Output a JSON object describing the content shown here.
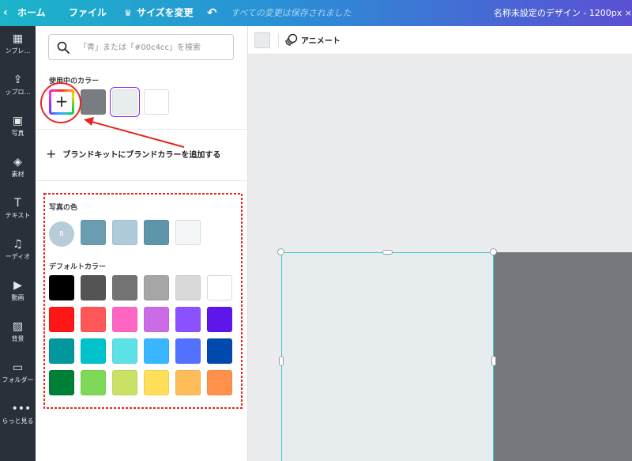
{
  "topbar": {
    "back_icon": "‹",
    "home": "ホーム",
    "file": "ファイル",
    "crown_icon": "♛",
    "resize": "サイズを変更",
    "undo_icon": "↶",
    "saved_status": "すべての変更は保存されました",
    "title": "名称未設定のデザイン - 1200px ×"
  },
  "rail": [
    {
      "icon": "template-icon",
      "glyph": "▦",
      "label": "ンプレ…"
    },
    {
      "icon": "upload-icon",
      "glyph": "⇪",
      "label": "ップロ…"
    },
    {
      "icon": "photo-icon",
      "glyph": "▣",
      "label": "写真"
    },
    {
      "icon": "elements-icon",
      "glyph": "◈",
      "label": "素材"
    },
    {
      "icon": "text-icon",
      "glyph": "T",
      "label": "テキスト"
    },
    {
      "icon": "audio-icon",
      "glyph": "♫",
      "label": "ーディオ"
    },
    {
      "icon": "video-icon",
      "glyph": "▶",
      "label": "動画"
    },
    {
      "icon": "background-icon",
      "glyph": "▨",
      "label": "背景"
    },
    {
      "icon": "folder-icon",
      "glyph": "▭",
      "label": "フォルダー"
    },
    {
      "icon": "more-icon",
      "glyph": "•••",
      "label": "らっと見る"
    }
  ],
  "search": {
    "placeholder": "「青」または「#00c4cc」を検索",
    "value": ""
  },
  "used_colors": {
    "label": "使用中のカラー",
    "add_label": "+",
    "colors": [
      "#797d82",
      "#e8edf0",
      "#ffffff"
    ],
    "selected_index": 1
  },
  "brand": {
    "label": "ブランドキットにブランドカラーを追加する",
    "plus": "+"
  },
  "photo_colors": {
    "label": "写真の色",
    "avatar_letter": "B",
    "avatar_color": "#b6ccd9",
    "colors": [
      "#6b9db0",
      "#afcbdb",
      "#5f95aa",
      "#f4f7f8"
    ]
  },
  "default_colors": {
    "label": "デフォルトカラー",
    "rows": [
      [
        "#000000",
        "#545454",
        "#737373",
        "#a6a6a6",
        "#d9d9d9",
        "#ffffff"
      ],
      [
        "#ff1616",
        "#ff5757",
        "#ff66c4",
        "#cb6ce6",
        "#8c52ff",
        "#5e17eb"
      ],
      [
        "#03989e",
        "#00c2cb",
        "#5ce1e6",
        "#38b6ff",
        "#5271ff",
        "#004aad"
      ],
      [
        "#008037",
        "#7ed957",
        "#c9e265",
        "#ffde59",
        "#ffbd59",
        "#ff914d"
      ]
    ]
  },
  "toolbar": {
    "animate": "アニメート",
    "bg_color": "#e8ecef"
  },
  "canvas": {
    "light_color": "#e7ecef",
    "dark_color": "#75797d",
    "selection_color": "#38c9d8"
  }
}
